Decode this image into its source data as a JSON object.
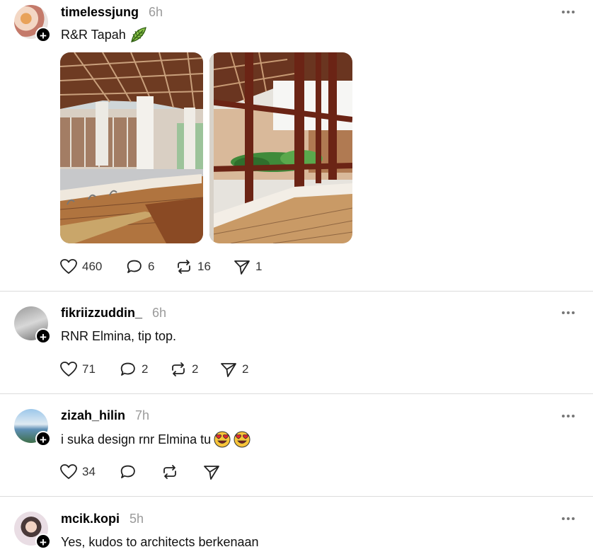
{
  "posts": [
    {
      "username": "timelessjung",
      "time": "6h",
      "text": "R&R Tapah",
      "emoji": "leaf",
      "likes": "460",
      "comments": "6",
      "reposts": "16",
      "shares": "1"
    },
    {
      "username": "fikriizzuddin_",
      "time": "6h",
      "text": "RNR Elmina, tip top.",
      "likes": "71",
      "comments": "2",
      "reposts": "2",
      "shares": "2"
    },
    {
      "username": "zizah_hilin",
      "time": "7h",
      "text": "i suka design rnr Elmina tu",
      "emoji": "heart-eyes",
      "likes": "34",
      "comments": "",
      "reposts": "",
      "shares": ""
    },
    {
      "username": "mcik.kopi",
      "time": "5h",
      "text": "Yes, kudos to architects berkenaan"
    }
  ],
  "icons": {
    "follow": "+"
  }
}
